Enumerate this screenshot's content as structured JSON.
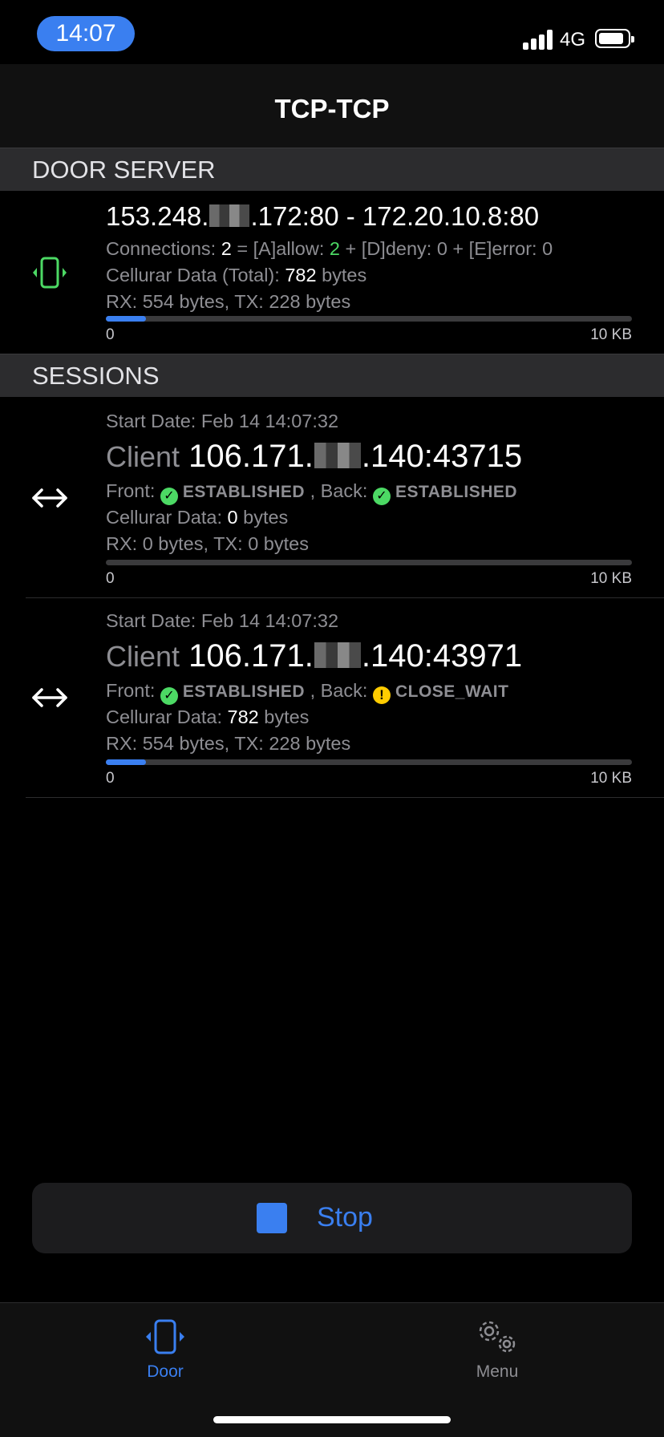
{
  "status_bar": {
    "time": "14:07",
    "network": "4G",
    "icons": [
      "signal-icon",
      "battery-icon"
    ]
  },
  "nav": {
    "title": "TCP-TCP"
  },
  "door_server": {
    "section_title": "DOOR SERVER",
    "icon": "phone-vibrate-icon",
    "address_prefix": "153.248.",
    "address_suffix": ".172:80 - 172.20.10.8:80",
    "connections_label": "Connections:",
    "connections_total": "2",
    "allow_text": "= [A]allow:",
    "allow_count": "2",
    "rest_text": "+ [D]deny: 0 + [E]error: 0",
    "data_label": "Cellurar Data (Total):",
    "data_value": "782",
    "data_unit": "bytes",
    "rx_tx": "RX: 554 bytes, TX: 228 bytes",
    "progress_fraction": 0.076,
    "bar_min": "0",
    "bar_max": "10 KB"
  },
  "sessions": {
    "section_title": "SESSIONS",
    "items": [
      {
        "icon": "arrow-left-right-icon",
        "start_date": "Start Date: Feb 14 14:07:32",
        "client_label": "Client",
        "client_prefix": "106.171.",
        "client_suffix": ".140:43715",
        "front_label": "Front:",
        "front_status": "ESTABLISHED",
        "back_label": ", Back:",
        "back_status": "ESTABLISHED",
        "back_state_icon": "check-circle-icon",
        "data_label": "Cellurar Data:",
        "data_value": "0",
        "data_unit": "bytes",
        "rx_tx": "RX: 0 bytes, TX: 0 bytes",
        "progress_fraction": 0.0,
        "bar_min": "0",
        "bar_max": "10 KB"
      },
      {
        "icon": "arrow-left-right-icon",
        "start_date": "Start Date: Feb 14 14:07:32",
        "client_label": "Client",
        "client_prefix": "106.171.",
        "client_suffix": ".140:43971",
        "front_label": "Front:",
        "front_status": "ESTABLISHED",
        "back_label": ", Back:",
        "back_status": "CLOSE_WAIT",
        "back_state_icon": "warning-circle-icon",
        "data_label": "Cellurar Data:",
        "data_value": "782",
        "data_unit": "bytes",
        "rx_tx": "RX: 554 bytes, TX: 228 bytes",
        "progress_fraction": 0.076,
        "bar_min": "0",
        "bar_max": "10 KB"
      }
    ]
  },
  "stop_button": {
    "label": "Stop",
    "icon": "stop-square-icon"
  },
  "tab_bar": {
    "tabs": [
      {
        "label": "Door",
        "icon": "door-phone-icon",
        "active": true
      },
      {
        "label": "Menu",
        "icon": "gears-icon",
        "active": false
      }
    ]
  },
  "colors": {
    "accent": "#3a7ff0",
    "success": "#4cd964",
    "warning": "#ffcc00",
    "background": "#000000"
  }
}
